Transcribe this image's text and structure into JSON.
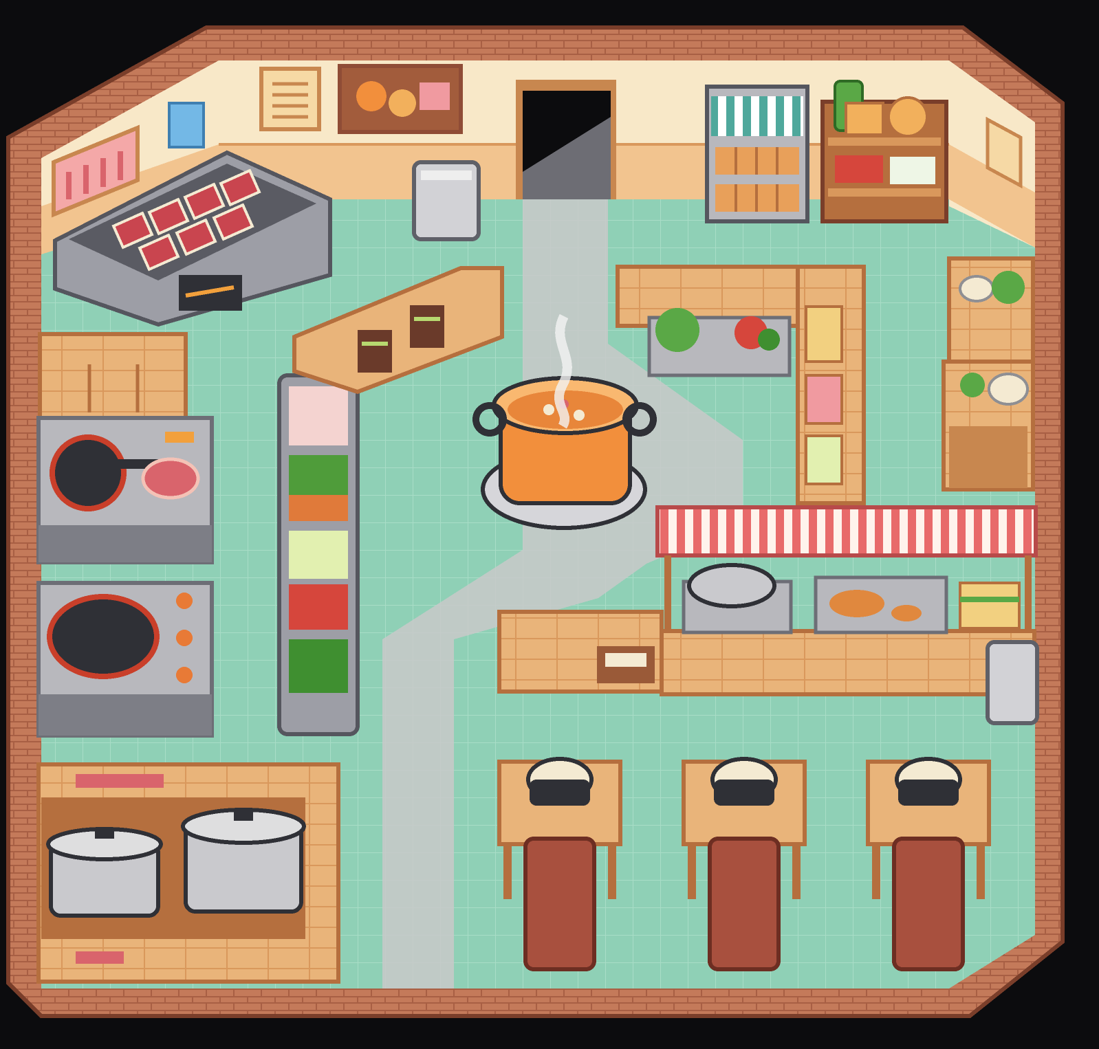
{
  "scene": {
    "type": "top-down pixel-art restaurant kitchen",
    "palette": {
      "background": "#0c0c0e",
      "brick": "#c47a5a",
      "brick_dark": "#8f4c36",
      "wall_cream": "#f8e8c8",
      "wainscot": "#f2c48f",
      "floor_tile": "#8fd0b6",
      "floor_line": "#a9ddc7",
      "walkway": "#c9c9c9",
      "wood": "#e9b47a",
      "wood_dark": "#c8874f",
      "steel": "#b8b8bd",
      "steel_dark": "#7d7e86",
      "pot_orange": "#f28f3c",
      "awning_red": "#e86a6a",
      "awning_teal": "#4fa89c",
      "greens": "#4f9c3a",
      "meat": "#d9646c",
      "rice": "#f4ead2"
    },
    "objects": [
      {
        "name": "doorway",
        "icon": "doorway-icon"
      },
      {
        "name": "grill-station",
        "icon": "grill-icon"
      },
      {
        "name": "center-soup-pot",
        "icon": "soup-pot-icon"
      },
      {
        "name": "frying-pan-stove",
        "icon": "frying-pan-icon"
      },
      {
        "name": "wok-stove",
        "icon": "wok-icon"
      },
      {
        "name": "ingredient-rack",
        "icon": "ingredient-rack-icon"
      },
      {
        "name": "display-fridge",
        "icon": "fridge-icon"
      },
      {
        "name": "pantry-shelf",
        "icon": "shelf-icon"
      },
      {
        "name": "serving-counter",
        "icon": "awning-counter-icon"
      },
      {
        "name": "stock-pots",
        "icon": "stock-pot-icon"
      },
      {
        "name": "dining-tables",
        "icon": "table-icon"
      },
      {
        "name": "trash-bin",
        "icon": "trash-bin-icon"
      }
    ],
    "dining_tables": [
      {
        "item": "rice-bowl"
      },
      {
        "item": "rice-bowl"
      },
      {
        "item": "rice-bowl"
      }
    ]
  }
}
